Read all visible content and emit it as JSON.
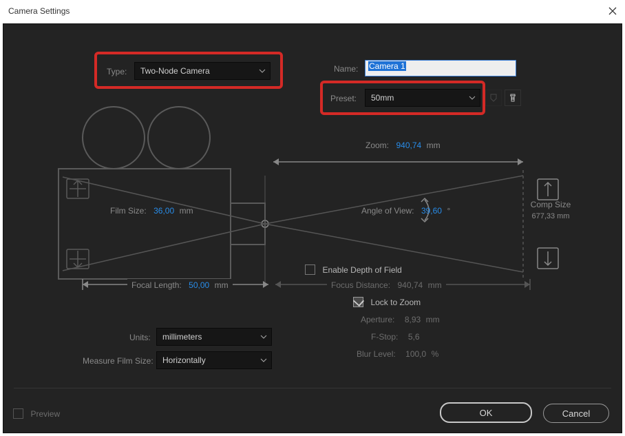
{
  "window": {
    "title": "Camera Settings"
  },
  "top": {
    "type_label": "Type:",
    "type_value": "Two-Node Camera",
    "name_label": "Name:",
    "name_value": "Camera 1",
    "preset_label": "Preset:",
    "preset_value": "50mm"
  },
  "diagram": {
    "zoom_label": "Zoom:",
    "zoom_value": "940,74",
    "zoom_unit": "mm",
    "film_size_label": "Film Size:",
    "film_size_value": "36,00",
    "film_size_unit": "mm",
    "angle_label": "Angle of View:",
    "angle_value": "39,60",
    "angle_unit": "°",
    "comp_size_label": "Comp Size",
    "comp_size_value": "677,33 mm",
    "focal_length_label": "Focal Length:",
    "focal_length_value": "50,00",
    "focal_length_unit": "mm"
  },
  "dof": {
    "enable_label": "Enable Depth of Field",
    "enable_checked": false,
    "focus_distance_label": "Focus Distance:",
    "focus_distance_value": "940,74",
    "focus_distance_unit": "mm",
    "lock_label": "Lock to Zoom",
    "lock_checked": true,
    "aperture_label": "Aperture:",
    "aperture_value": "8,93",
    "aperture_unit": "mm",
    "fstop_label": "F-Stop:",
    "fstop_value": "5,6",
    "blur_label": "Blur Level:",
    "blur_value": "100,0",
    "blur_unit": "%"
  },
  "bottom": {
    "units_label": "Units:",
    "units_value": "millimeters",
    "measure_label": "Measure Film Size:",
    "measure_value": "Horizontally",
    "preview_label": "Preview",
    "ok_label": "OK",
    "cancel_label": "Cancel"
  }
}
